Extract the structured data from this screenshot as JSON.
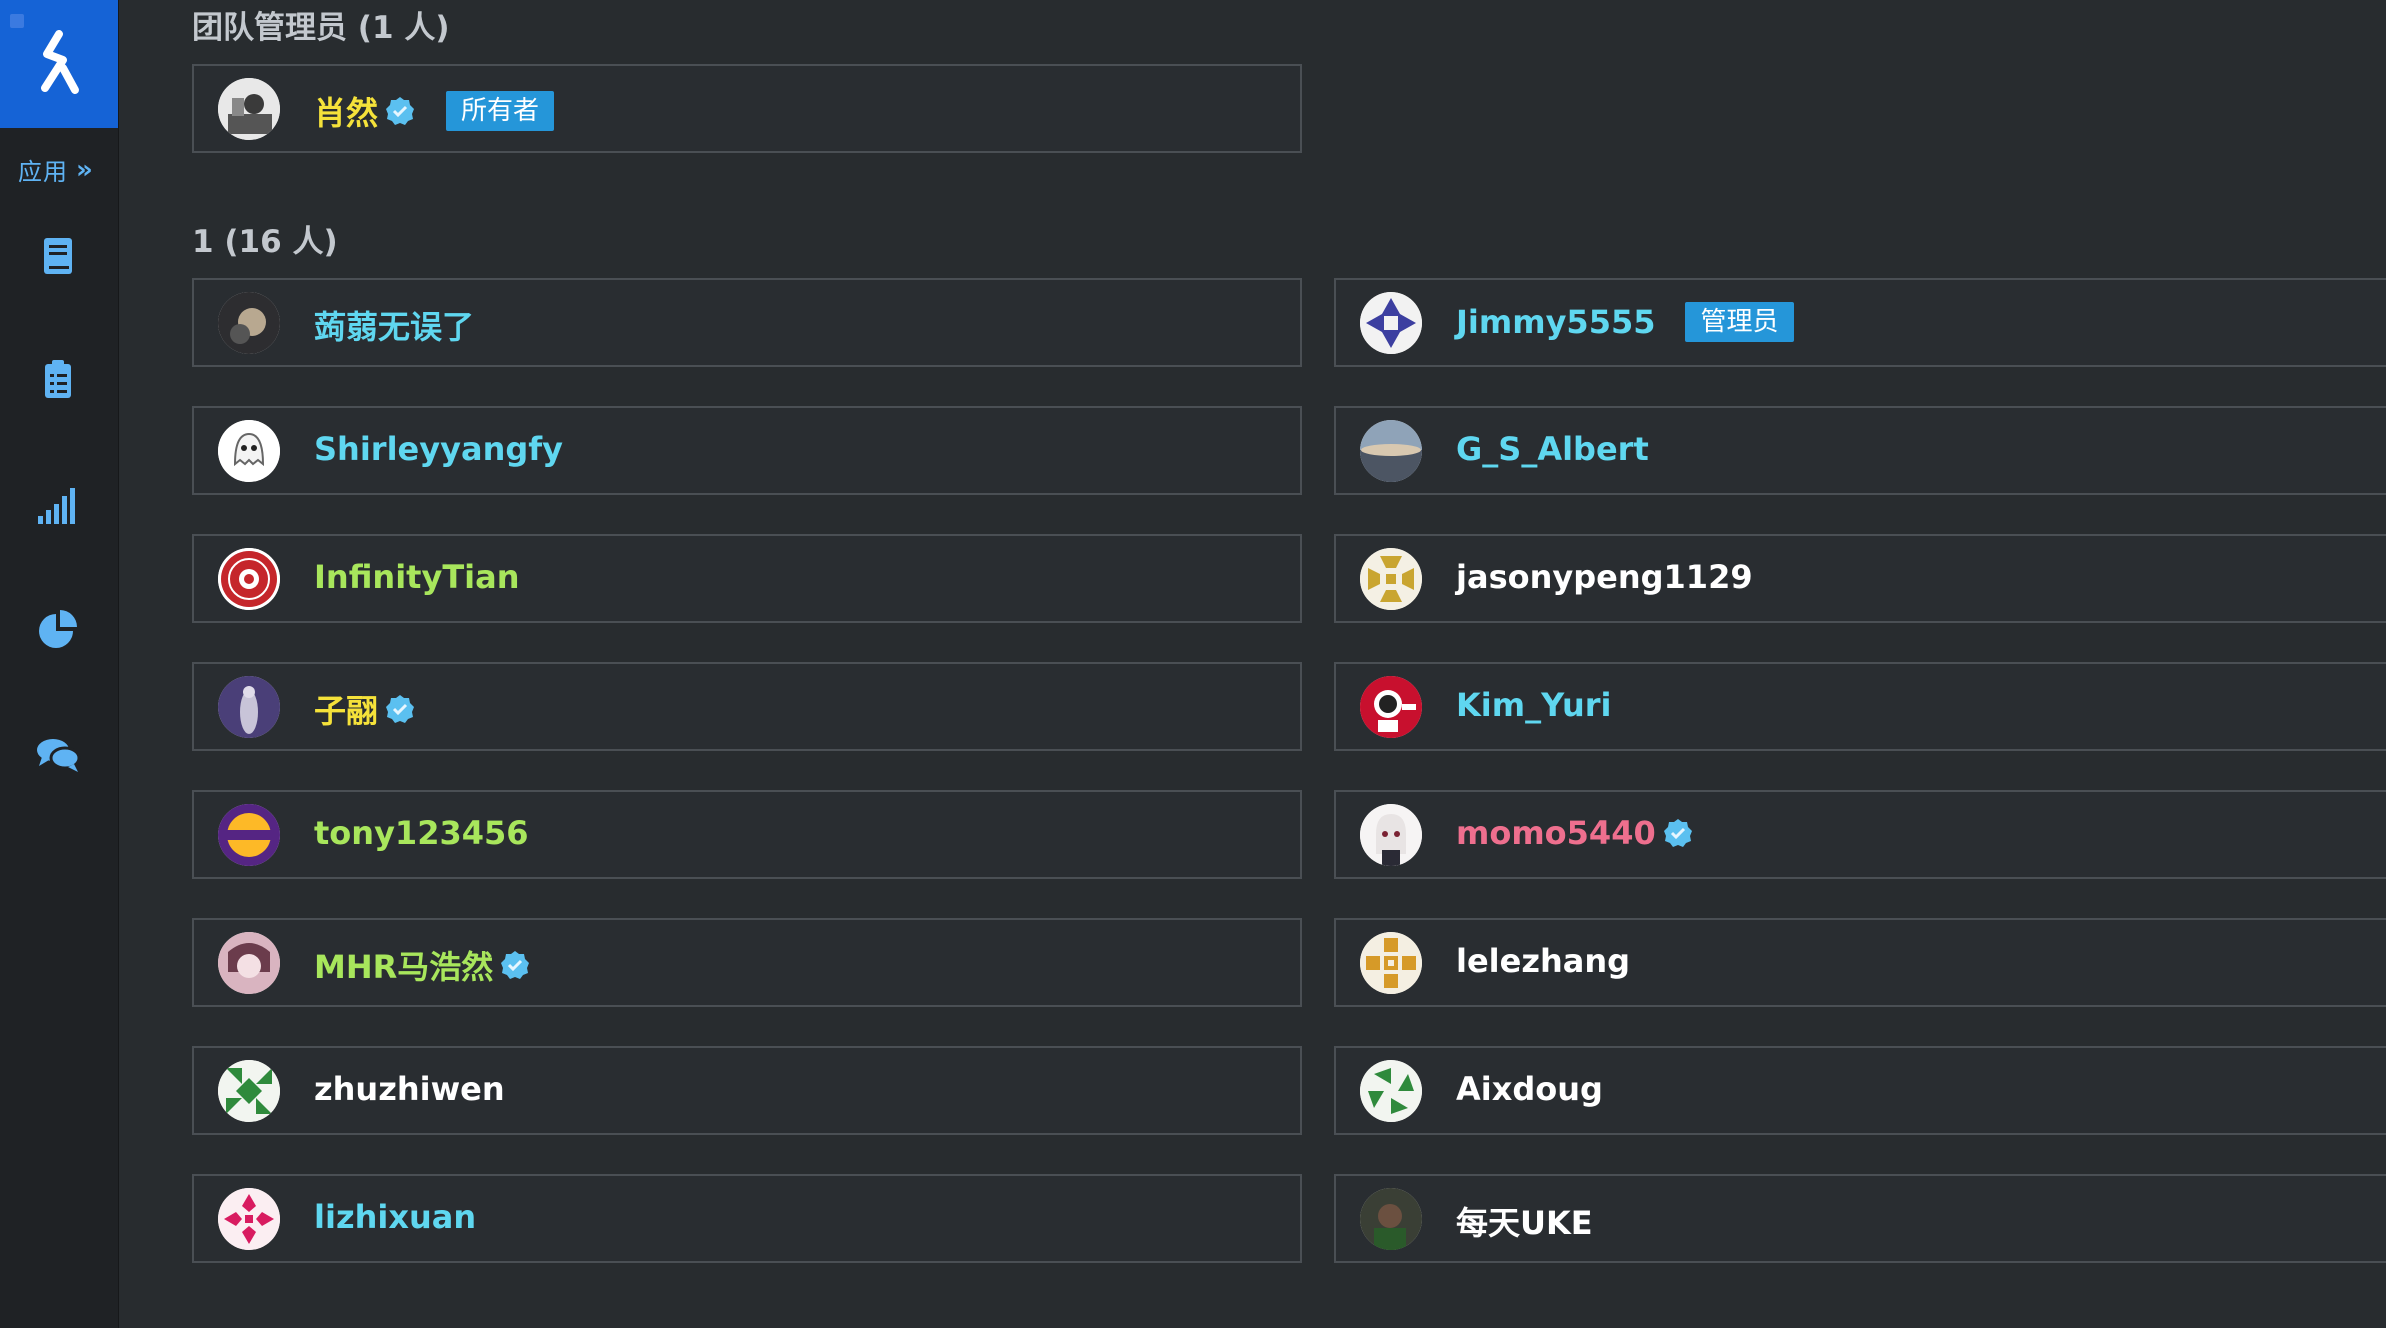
{
  "nav": {
    "apps_label": "应用",
    "apps_chevron": "»",
    "items": [
      "book-icon",
      "clipboard-icon",
      "signal-bars-icon",
      "pie-chart-icon",
      "comments-icon"
    ]
  },
  "sections": {
    "admins": {
      "title": "团队管理员 (1 人)",
      "members": [
        {
          "name": "肖然",
          "color": "#f5e23a",
          "verified": true,
          "badge": "所有者"
        }
      ]
    },
    "team": {
      "title": "1 (16 人)",
      "members": [
        {
          "name": "蒟蒻无误了",
          "color": "#5fd7f0"
        },
        {
          "name": "Jimmy5555",
          "color": "#5fd7f0",
          "badge": "管理员"
        },
        {
          "name": "Shirleyyangfy",
          "color": "#5fd7f0"
        },
        {
          "name": "G_S_Albert",
          "color": "#5fd7f0"
        },
        {
          "name": "InfinityTian",
          "color": "#a8e65c"
        },
        {
          "name": "jasonypeng1129",
          "color": "#ffffff"
        },
        {
          "name": "子翮",
          "color": "#f5e23a",
          "verified": true
        },
        {
          "name": "Kim_Yuri",
          "color": "#5fd7f0"
        },
        {
          "name": "tony123456",
          "color": "#a8e65c"
        },
        {
          "name": "momo5440",
          "color": "#ee6f8e",
          "verified": true
        },
        {
          "name": "MHR马浩然",
          "color": "#a8e65c",
          "verified": true
        },
        {
          "name": "lelezhang",
          "color": "#ffffff"
        },
        {
          "name": "zhuzhiwen",
          "color": "#ffffff"
        },
        {
          "name": "Aixdoug",
          "color": "#ffffff"
        },
        {
          "name": "lizhixuan",
          "color": "#5fd7f0"
        },
        {
          "name": "每天UKE",
          "color": "#ffffff"
        }
      ]
    }
  },
  "accent": "#1563d6",
  "badge_color": "#2596d9",
  "verified_color": "#5bc0f0"
}
